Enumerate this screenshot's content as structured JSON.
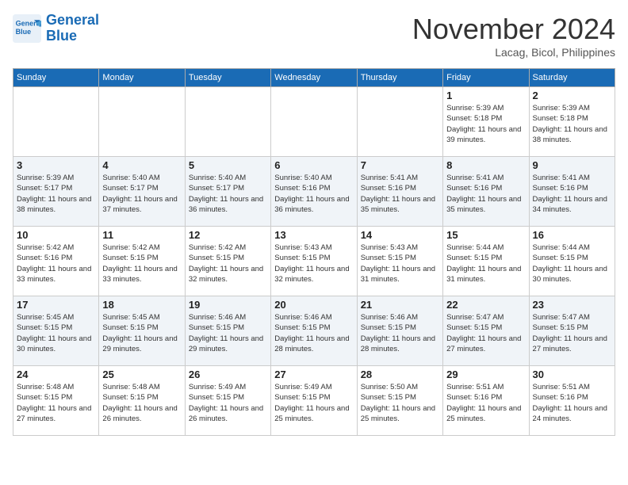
{
  "header": {
    "logo_line1": "General",
    "logo_line2": "Blue",
    "month": "November 2024",
    "location": "Lacag, Bicol, Philippines"
  },
  "weekdays": [
    "Sunday",
    "Monday",
    "Tuesday",
    "Wednesday",
    "Thursday",
    "Friday",
    "Saturday"
  ],
  "weeks": [
    [
      {
        "day": "",
        "info": ""
      },
      {
        "day": "",
        "info": ""
      },
      {
        "day": "",
        "info": ""
      },
      {
        "day": "",
        "info": ""
      },
      {
        "day": "",
        "info": ""
      },
      {
        "day": "1",
        "info": "Sunrise: 5:39 AM\nSunset: 5:18 PM\nDaylight: 11 hours and 39 minutes."
      },
      {
        "day": "2",
        "info": "Sunrise: 5:39 AM\nSunset: 5:18 PM\nDaylight: 11 hours and 38 minutes."
      }
    ],
    [
      {
        "day": "3",
        "info": "Sunrise: 5:39 AM\nSunset: 5:17 PM\nDaylight: 11 hours and 38 minutes."
      },
      {
        "day": "4",
        "info": "Sunrise: 5:40 AM\nSunset: 5:17 PM\nDaylight: 11 hours and 37 minutes."
      },
      {
        "day": "5",
        "info": "Sunrise: 5:40 AM\nSunset: 5:17 PM\nDaylight: 11 hours and 36 minutes."
      },
      {
        "day": "6",
        "info": "Sunrise: 5:40 AM\nSunset: 5:16 PM\nDaylight: 11 hours and 36 minutes."
      },
      {
        "day": "7",
        "info": "Sunrise: 5:41 AM\nSunset: 5:16 PM\nDaylight: 11 hours and 35 minutes."
      },
      {
        "day": "8",
        "info": "Sunrise: 5:41 AM\nSunset: 5:16 PM\nDaylight: 11 hours and 35 minutes."
      },
      {
        "day": "9",
        "info": "Sunrise: 5:41 AM\nSunset: 5:16 PM\nDaylight: 11 hours and 34 minutes."
      }
    ],
    [
      {
        "day": "10",
        "info": "Sunrise: 5:42 AM\nSunset: 5:16 PM\nDaylight: 11 hours and 33 minutes."
      },
      {
        "day": "11",
        "info": "Sunrise: 5:42 AM\nSunset: 5:15 PM\nDaylight: 11 hours and 33 minutes."
      },
      {
        "day": "12",
        "info": "Sunrise: 5:42 AM\nSunset: 5:15 PM\nDaylight: 11 hours and 32 minutes."
      },
      {
        "day": "13",
        "info": "Sunrise: 5:43 AM\nSunset: 5:15 PM\nDaylight: 11 hours and 32 minutes."
      },
      {
        "day": "14",
        "info": "Sunrise: 5:43 AM\nSunset: 5:15 PM\nDaylight: 11 hours and 31 minutes."
      },
      {
        "day": "15",
        "info": "Sunrise: 5:44 AM\nSunset: 5:15 PM\nDaylight: 11 hours and 31 minutes."
      },
      {
        "day": "16",
        "info": "Sunrise: 5:44 AM\nSunset: 5:15 PM\nDaylight: 11 hours and 30 minutes."
      }
    ],
    [
      {
        "day": "17",
        "info": "Sunrise: 5:45 AM\nSunset: 5:15 PM\nDaylight: 11 hours and 30 minutes."
      },
      {
        "day": "18",
        "info": "Sunrise: 5:45 AM\nSunset: 5:15 PM\nDaylight: 11 hours and 29 minutes."
      },
      {
        "day": "19",
        "info": "Sunrise: 5:46 AM\nSunset: 5:15 PM\nDaylight: 11 hours and 29 minutes."
      },
      {
        "day": "20",
        "info": "Sunrise: 5:46 AM\nSunset: 5:15 PM\nDaylight: 11 hours and 28 minutes."
      },
      {
        "day": "21",
        "info": "Sunrise: 5:46 AM\nSunset: 5:15 PM\nDaylight: 11 hours and 28 minutes."
      },
      {
        "day": "22",
        "info": "Sunrise: 5:47 AM\nSunset: 5:15 PM\nDaylight: 11 hours and 27 minutes."
      },
      {
        "day": "23",
        "info": "Sunrise: 5:47 AM\nSunset: 5:15 PM\nDaylight: 11 hours and 27 minutes."
      }
    ],
    [
      {
        "day": "24",
        "info": "Sunrise: 5:48 AM\nSunset: 5:15 PM\nDaylight: 11 hours and 27 minutes."
      },
      {
        "day": "25",
        "info": "Sunrise: 5:48 AM\nSunset: 5:15 PM\nDaylight: 11 hours and 26 minutes."
      },
      {
        "day": "26",
        "info": "Sunrise: 5:49 AM\nSunset: 5:15 PM\nDaylight: 11 hours and 26 minutes."
      },
      {
        "day": "27",
        "info": "Sunrise: 5:49 AM\nSunset: 5:15 PM\nDaylight: 11 hours and 25 minutes."
      },
      {
        "day": "28",
        "info": "Sunrise: 5:50 AM\nSunset: 5:15 PM\nDaylight: 11 hours and 25 minutes."
      },
      {
        "day": "29",
        "info": "Sunrise: 5:51 AM\nSunset: 5:16 PM\nDaylight: 11 hours and 25 minutes."
      },
      {
        "day": "30",
        "info": "Sunrise: 5:51 AM\nSunset: 5:16 PM\nDaylight: 11 hours and 24 minutes."
      }
    ]
  ]
}
